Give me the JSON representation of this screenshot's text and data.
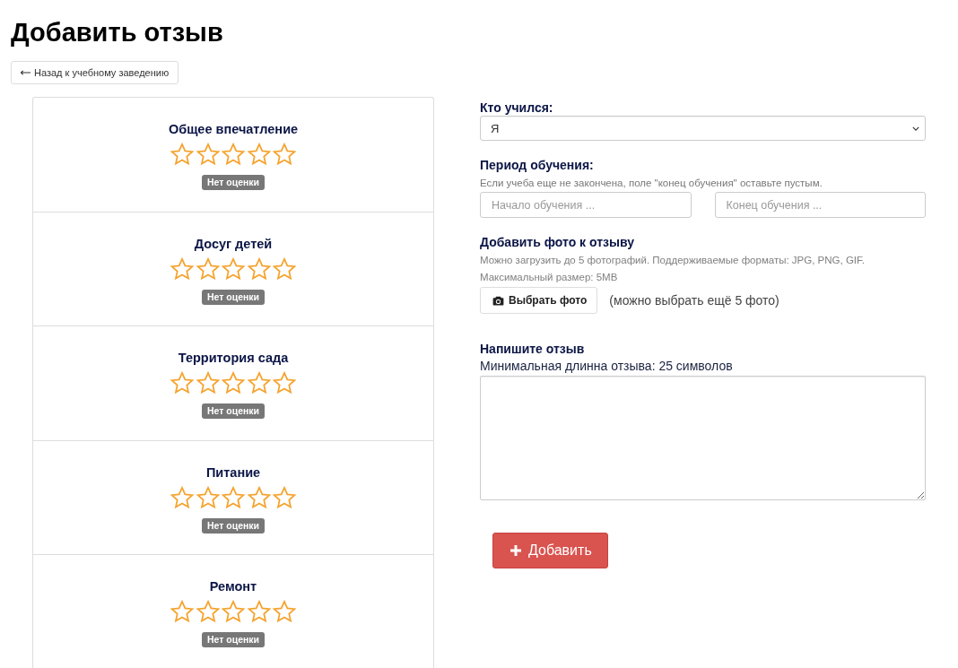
{
  "page": {
    "title": "Добавить отзыв",
    "back_button": "Назад к учебному заведению"
  },
  "ratings": [
    {
      "title": "Общее впечатление",
      "stars": 0,
      "status": "Нет оценки"
    },
    {
      "title": "Досуг детей",
      "stars": 0,
      "status": "Нет оценки"
    },
    {
      "title": "Территория сада",
      "stars": 0,
      "status": "Нет оценки"
    },
    {
      "title": "Питание",
      "stars": 0,
      "status": "Нет оценки"
    },
    {
      "title": "Ремонт",
      "stars": 0,
      "status": "Нет оценки"
    }
  ],
  "who_studied": {
    "label": "Кто учился:",
    "value": "Я"
  },
  "period": {
    "label": "Период обучения:",
    "hint": "Если учеба еще не закончена, поле \"конец обучения\" оставьте пустым.",
    "fields": [
      {
        "placeholder": "Начало обучения ..."
      },
      {
        "placeholder": "Конец обучения ..."
      }
    ]
  },
  "photos": {
    "label": "Добавить фото к отзыву",
    "hint_lines": [
      "Можно загрузить до 5 фотографий. Поддерживаемые форматы: JPG, PNG, GIF.",
      "Максимальный размер: 5MB"
    ],
    "button": "Выбрать фото",
    "remaining": "(можно выбрать ещё 5 фото)"
  },
  "review": {
    "label": "Напишите отзыв",
    "hint": "Минимальная длинна отзыва: 25 символов"
  },
  "submit_button": "Добавить"
}
